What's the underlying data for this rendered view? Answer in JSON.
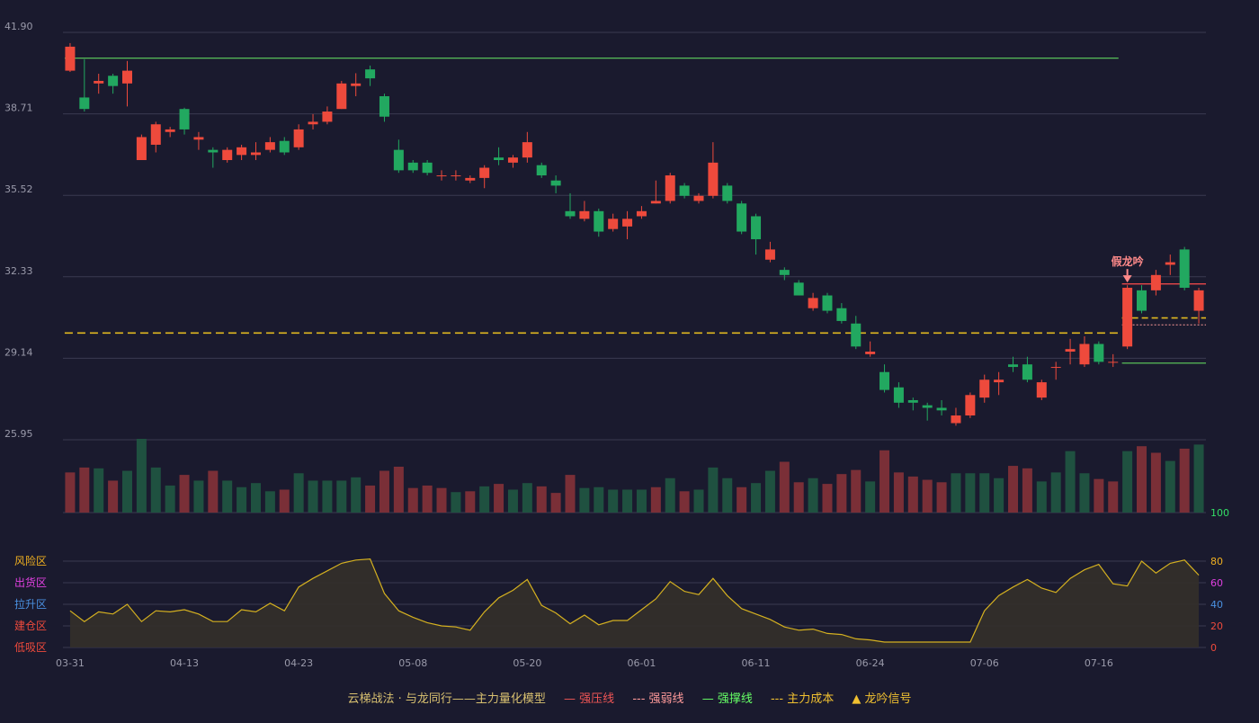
{
  "chart_data": {
    "type": "candlestick",
    "price_axis": {
      "ticks": [
        "41.90",
        "38.71",
        "35.52",
        "32.33",
        "29.14",
        "25.95"
      ],
      "ylim": [
        25.95,
        41.9
      ]
    },
    "x_axis": {
      "ticks": [
        {
          "label": "03-31",
          "i": 0
        },
        {
          "label": "04-13",
          "i": 8
        },
        {
          "label": "04-23",
          "i": 16
        },
        {
          "label": "05-08",
          "i": 24
        },
        {
          "label": "05-20",
          "i": 32
        },
        {
          "label": "06-01",
          "i": 40
        },
        {
          "label": "06-11",
          "i": 48
        },
        {
          "label": "06-24",
          "i": 56
        },
        {
          "label": "07-06",
          "i": 64
        },
        {
          "label": "07-16",
          "i": 72
        }
      ]
    },
    "candles": [
      [
        40.4,
        41.34,
        41.48,
        40.35
      ],
      [
        39.35,
        38.9,
        40.85,
        38.8
      ],
      [
        39.9,
        40.0,
        40.28,
        39.5
      ],
      [
        40.2,
        39.8,
        40.28,
        39.5
      ],
      [
        39.9,
        40.4,
        40.78,
        39.0
      ],
      [
        36.9,
        37.8,
        37.9,
        36.9
      ],
      [
        37.5,
        38.3,
        38.4,
        37.2
      ],
      [
        38.0,
        38.1,
        38.2,
        37.8
      ],
      [
        38.9,
        38.1,
        38.95,
        37.9
      ],
      [
        37.7,
        37.8,
        38.0,
        37.3
      ],
      [
        37.3,
        37.2,
        37.4,
        36.6
      ],
      [
        36.9,
        37.3,
        37.4,
        36.8
      ],
      [
        37.1,
        37.4,
        37.5,
        36.9
      ],
      [
        37.1,
        37.2,
        37.6,
        36.9
      ],
      [
        37.3,
        37.6,
        37.8,
        37.2
      ],
      [
        37.65,
        37.2,
        37.8,
        37.1
      ],
      [
        37.4,
        38.1,
        38.3,
        37.3
      ],
      [
        38.3,
        38.4,
        38.7,
        38.1
      ],
      [
        38.4,
        38.8,
        39.0,
        38.3
      ],
      [
        38.9,
        39.9,
        40.0,
        38.9
      ],
      [
        39.8,
        39.9,
        40.3,
        39.4
      ],
      [
        40.45,
        40.1,
        40.6,
        39.8
      ],
      [
        39.4,
        38.6,
        39.5,
        38.4
      ],
      [
        37.3,
        36.5,
        37.7,
        36.4
      ],
      [
        36.8,
        36.5,
        36.9,
        36.4
      ],
      [
        36.8,
        36.4,
        36.9,
        36.3
      ],
      [
        36.3,
        36.3,
        36.5,
        36.1
      ],
      [
        36.3,
        36.3,
        36.5,
        36.1
      ],
      [
        36.1,
        36.2,
        36.3,
        36.0
      ],
      [
        36.2,
        36.6,
        36.7,
        35.8
      ],
      [
        37.0,
        36.9,
        37.4,
        36.7
      ],
      [
        36.8,
        37.0,
        37.1,
        36.6
      ],
      [
        37.0,
        37.6,
        38.0,
        36.8
      ],
      [
        36.7,
        36.3,
        36.8,
        36.2
      ],
      [
        36.1,
        35.9,
        36.3,
        35.6
      ],
      [
        34.9,
        34.7,
        35.6,
        34.6
      ],
      [
        34.6,
        34.9,
        35.3,
        34.5
      ],
      [
        34.9,
        34.1,
        35.0,
        33.9
      ],
      [
        34.2,
        34.6,
        34.8,
        34.1
      ],
      [
        34.3,
        34.6,
        34.9,
        33.8
      ],
      [
        34.7,
        34.9,
        35.1,
        34.6
      ],
      [
        35.2,
        35.3,
        36.1,
        35.2
      ],
      [
        35.3,
        36.3,
        36.4,
        35.2
      ],
      [
        35.9,
        35.5,
        36.0,
        35.4
      ],
      [
        35.3,
        35.5,
        35.6,
        35.2
      ],
      [
        35.5,
        36.8,
        37.6,
        35.4
      ],
      [
        35.9,
        35.3,
        36.0,
        35.2
      ],
      [
        35.2,
        34.1,
        35.3,
        34.0
      ],
      [
        34.7,
        33.8,
        34.8,
        33.2
      ],
      [
        33.0,
        33.4,
        33.7,
        32.9
      ],
      [
        32.6,
        32.4,
        32.7,
        32.2
      ],
      [
        32.1,
        31.6,
        32.2,
        31.6
      ],
      [
        31.1,
        31.5,
        31.7,
        31.0
      ],
      [
        31.6,
        31.0,
        31.7,
        30.9
      ],
      [
        31.1,
        30.6,
        31.3,
        30.5
      ],
      [
        30.5,
        29.6,
        30.8,
        29.5
      ],
      [
        29.3,
        29.4,
        29.8,
        29.2
      ],
      [
        28.6,
        27.9,
        28.9,
        27.8
      ],
      [
        28.0,
        27.4,
        28.2,
        27.2
      ],
      [
        27.5,
        27.4,
        27.6,
        27.1
      ],
      [
        27.3,
        27.2,
        27.4,
        26.7
      ],
      [
        27.2,
        27.1,
        27.5,
        26.9
      ],
      [
        26.6,
        26.9,
        27.2,
        26.5
      ],
      [
        26.9,
        27.7,
        27.8,
        26.8
      ],
      [
        27.6,
        28.3,
        28.5,
        27.4
      ],
      [
        28.2,
        28.3,
        28.6,
        27.7
      ],
      [
        28.9,
        28.8,
        29.2,
        28.6
      ],
      [
        28.9,
        28.3,
        29.2,
        28.2
      ],
      [
        27.6,
        28.2,
        28.3,
        27.5
      ],
      [
        28.8,
        28.8,
        29.0,
        28.3
      ],
      [
        29.4,
        29.5,
        29.9,
        28.9
      ],
      [
        28.9,
        29.7,
        30.0,
        28.8
      ],
      [
        29.7,
        29.0,
        29.8,
        28.9
      ],
      [
        29.0,
        29.0,
        29.3,
        28.8
      ],
      [
        29.6,
        31.9,
        32.0,
        29.5
      ],
      [
        31.8,
        31.0,
        32.0,
        30.9
      ],
      [
        31.8,
        32.4,
        32.6,
        31.6
      ],
      [
        32.8,
        32.9,
        33.2,
        32.4
      ],
      [
        33.4,
        31.9,
        33.5,
        31.8
      ],
      [
        31.0,
        31.8,
        31.9,
        30.5
      ]
    ],
    "volume": [
      [
        49,
        "down"
      ],
      [
        55,
        "down"
      ],
      [
        54,
        "up"
      ],
      [
        39,
        "down"
      ],
      [
        51,
        "up"
      ],
      [
        90,
        "up"
      ],
      [
        55,
        "up"
      ],
      [
        33,
        "up"
      ],
      [
        46,
        "down"
      ],
      [
        39,
        "up"
      ],
      [
        51,
        "down"
      ],
      [
        39,
        "up"
      ],
      [
        31,
        "up"
      ],
      [
        36,
        "up"
      ],
      [
        26,
        "up"
      ],
      [
        28,
        "down"
      ],
      [
        48,
        "up"
      ],
      [
        39,
        "up"
      ],
      [
        39,
        "up"
      ],
      [
        39,
        "up"
      ],
      [
        43,
        "up"
      ],
      [
        33,
        "down"
      ],
      [
        51,
        "down"
      ],
      [
        56,
        "down"
      ],
      [
        30,
        "down"
      ],
      [
        33,
        "down"
      ],
      [
        30,
        "down"
      ],
      [
        25,
        "up"
      ],
      [
        26,
        "down"
      ],
      [
        32,
        "up"
      ],
      [
        35,
        "down"
      ],
      [
        28,
        "up"
      ],
      [
        36,
        "up"
      ],
      [
        32,
        "down"
      ],
      [
        24,
        "down"
      ],
      [
        46,
        "down"
      ],
      [
        30,
        "up"
      ],
      [
        31,
        "up"
      ],
      [
        28,
        "up"
      ],
      [
        28,
        "up"
      ],
      [
        28,
        "up"
      ],
      [
        31,
        "down"
      ],
      [
        42,
        "up"
      ],
      [
        26,
        "down"
      ],
      [
        28,
        "up"
      ],
      [
        55,
        "up"
      ],
      [
        42,
        "up"
      ],
      [
        31,
        "down"
      ],
      [
        36,
        "up"
      ],
      [
        51,
        "up"
      ],
      [
        62,
        "down"
      ],
      [
        37,
        "down"
      ],
      [
        42,
        "up"
      ],
      [
        35,
        "down"
      ],
      [
        47,
        "down"
      ],
      [
        52,
        "down"
      ],
      [
        38,
        "up"
      ],
      [
        76,
        "down"
      ],
      [
        49,
        "down"
      ],
      [
        44,
        "down"
      ],
      [
        40,
        "down"
      ],
      [
        37,
        "down"
      ],
      [
        48,
        "up"
      ],
      [
        48,
        "up"
      ],
      [
        48,
        "up"
      ],
      [
        42,
        "up"
      ],
      [
        57,
        "down"
      ],
      [
        54,
        "down"
      ],
      [
        38,
        "up"
      ],
      [
        49,
        "up"
      ],
      [
        75,
        "up"
      ],
      [
        48,
        "up"
      ],
      [
        41,
        "down"
      ],
      [
        38,
        "down"
      ],
      [
        75,
        "up"
      ],
      [
        81,
        "down"
      ],
      [
        73,
        "down"
      ],
      [
        63,
        "up"
      ],
      [
        78,
        "down"
      ],
      [
        83,
        "up"
      ]
    ],
    "lines": {
      "strong_resistance_top": {
        "value": 40.89,
        "from": 0,
        "to": 73
      },
      "main_cost": {
        "value": 30.13,
        "from": 0,
        "to": 73
      },
      "strong_resistance": {
        "value": 32.05,
        "from": 74,
        "to": 79
      },
      "main_cost_2": {
        "value": 30.72,
        "from": 74,
        "to": 79
      },
      "weak_line": {
        "value": 30.45,
        "from": 74,
        "to": 79
      },
      "strong_support": {
        "value": 28.95,
        "from": 74,
        "to": 79
      }
    },
    "signal": {
      "label": "假龙吟",
      "index": 74
    },
    "indicator": {
      "ylim": [
        0,
        100
      ],
      "ticks": [
        "100",
        "80",
        "60",
        "40",
        "20",
        "0"
      ],
      "zones": [
        "风险区",
        "出货区",
        "拉升区",
        "建仓区",
        "低吸区"
      ],
      "values": [
        34,
        24,
        33,
        31,
        40,
        24,
        34,
        33,
        35,
        31,
        24,
        24,
        35,
        33,
        41,
        34,
        56,
        64,
        71,
        78,
        81,
        82,
        50,
        34,
        28,
        23,
        20,
        19,
        16,
        33,
        46,
        53,
        63,
        39,
        32,
        22,
        30,
        21,
        25,
        25,
        35,
        45,
        61,
        52,
        49,
        64,
        48,
        36,
        31,
        26,
        19,
        16,
        17,
        13,
        12,
        8,
        7,
        5,
        5,
        5,
        5,
        5,
        5,
        5,
        34,
        48,
        56,
        63,
        55,
        51,
        64,
        72,
        77,
        59,
        57,
        80,
        69,
        78,
        81,
        67
      ]
    }
  },
  "legend": {
    "model": "云梯战法 · 与龙同行——主力量化模型",
    "strong_resistance": "强压线",
    "weak": "强弱线",
    "strong_support": "强撑线",
    "main_cost": "主力成本",
    "signal": "龙吟信号"
  },
  "colors": {
    "background": "#1a1a2e",
    "up": "#ee4a3c",
    "down": "#22a860",
    "vol_up": "#7a2f37",
    "vol_down": "#1f5140",
    "grid": "#3a3a50",
    "axis_text": "#9a9aaa",
    "indicator_line": "#d4b020",
    "cost_line": "#e0b820",
    "resistance_line": "#ff4d4d",
    "support_line": "#5fd35f"
  }
}
